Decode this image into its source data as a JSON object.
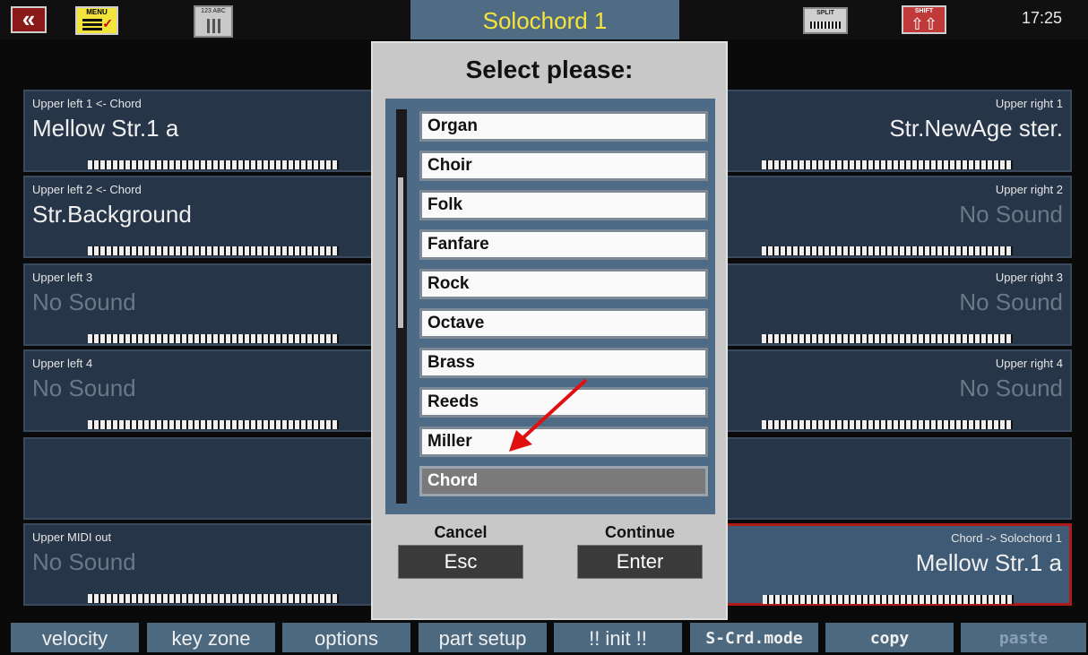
{
  "header": {
    "title": "Solochord 1",
    "clock": "17:25",
    "menu_label": "MENU",
    "abc_label": "123 ABC",
    "split_label": "SPLIT",
    "shift_label": "SHIFT"
  },
  "panels_left": [
    {
      "label": "Upper left 1  <- Chord",
      "name": "Mellow Str.1  a"
    },
    {
      "label": "Upper left 2  <- Chord",
      "name": "Str.Background"
    },
    {
      "label": "Upper left 3",
      "name": "No Sound"
    },
    {
      "label": "Upper left 4",
      "name": "No Sound"
    },
    {
      "label": "Upper MIDI out",
      "name": "No Sound"
    }
  ],
  "panels_right": [
    {
      "label": "Upper  right  1",
      "name": "Str.NewAge  ster."
    },
    {
      "label": "Upper  right  2",
      "name": "No  Sound"
    },
    {
      "label": "Upper  right  3",
      "name": "No  Sound"
    },
    {
      "label": "Upper  right  4",
      "name": "No  Sound"
    },
    {
      "label": "Chord  ->     Solochord  1",
      "name": "Mellow  Str.1       a"
    }
  ],
  "dialog": {
    "title": "Select please:",
    "items": [
      "Organ",
      "Choir",
      "Folk",
      "Fanfare",
      "Rock",
      "Octave",
      "Brass",
      "Reeds",
      "Miller",
      "Chord"
    ],
    "selected": "Chord",
    "cancel_label": "Cancel",
    "cancel_key": "Esc",
    "continue_label": "Continue",
    "continue_key": "Enter"
  },
  "bottom_bar": [
    "velocity",
    "key zone",
    "options",
    "part setup",
    "!! init !!",
    "S-Crd.mode",
    "copy",
    "paste"
  ],
  "colors": {
    "accent_title": "#f6e43a",
    "selected_border": "#b01a1a",
    "annotation_arrow": "#e01010"
  }
}
